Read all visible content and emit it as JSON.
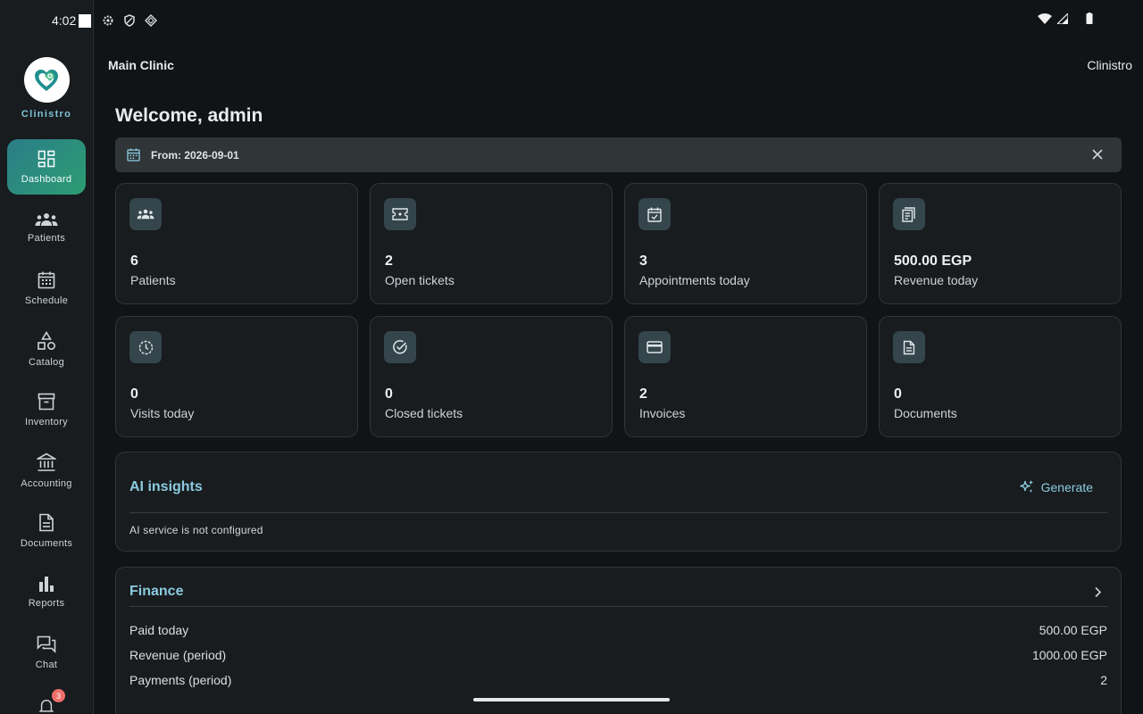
{
  "status": {
    "time": "4:02"
  },
  "sidebar": {
    "brand": "Clinistro",
    "items": [
      {
        "label": "Dashboard",
        "icon": "dashboard-icon",
        "active": true
      },
      {
        "label": "Patients",
        "icon": "people-icon"
      },
      {
        "label": "Schedule",
        "icon": "calendar-grid-icon"
      },
      {
        "label": "Catalog",
        "icon": "shapes-icon"
      },
      {
        "label": "Inventory",
        "icon": "archive-box-icon"
      },
      {
        "label": "Accounting",
        "icon": "bank-icon"
      },
      {
        "label": "Documents",
        "icon": "document-icon"
      },
      {
        "label": "Reports",
        "icon": "bar-chart-icon"
      },
      {
        "label": "Chat",
        "icon": "chat-icon"
      }
    ],
    "notifications_badge": "3"
  },
  "header": {
    "clinic": "Main Clinic",
    "app_name": "Clinistro"
  },
  "welcome": "Welcome, admin",
  "filter": {
    "label": "From: 2026-09-01"
  },
  "stats": [
    {
      "value": "6",
      "label": "Patients",
      "icon": "people-icon"
    },
    {
      "value": "2",
      "label": "Open tickets",
      "icon": "ticket-icon"
    },
    {
      "value": "3",
      "label": "Appointments today",
      "icon": "calendar-check-icon"
    },
    {
      "value": "500.00 EGP",
      "label": "Revenue today",
      "icon": "receipt-icon"
    },
    {
      "value": "0",
      "label": "Visits today",
      "icon": "clock-icon"
    },
    {
      "value": "0",
      "label": "Closed tickets",
      "icon": "check-circle-icon"
    },
    {
      "value": "2",
      "label": "Invoices",
      "icon": "credit-card-icon"
    },
    {
      "value": "0",
      "label": "Documents",
      "icon": "document-icon"
    }
  ],
  "ai": {
    "title": "AI insights",
    "button": "Generate",
    "message": "AI service is not configured"
  },
  "finance": {
    "title": "Finance",
    "rows": [
      {
        "label": "Paid today",
        "value": "500.00 EGP"
      },
      {
        "label": "Revenue (period)",
        "value": "1000.00 EGP"
      },
      {
        "label": "Payments (period)",
        "value": "2"
      }
    ]
  }
}
